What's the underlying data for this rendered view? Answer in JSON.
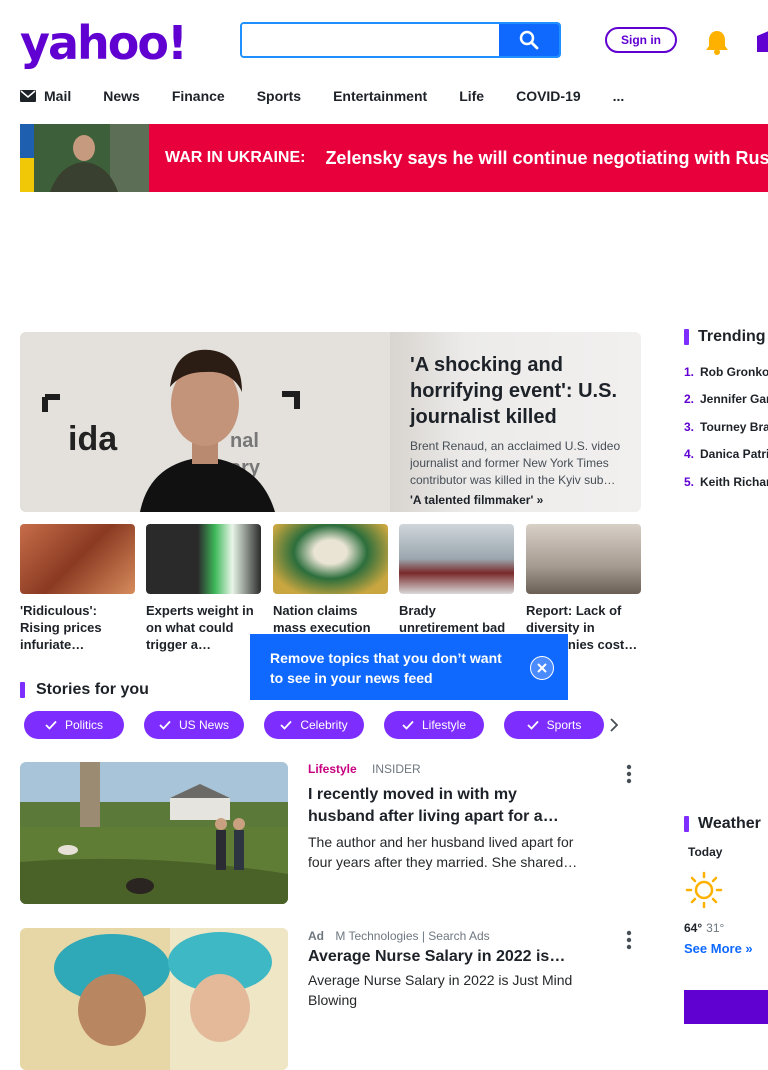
{
  "header": {
    "logo": "yahoo!",
    "search_placeholder": "",
    "sign_in": "Sign in"
  },
  "nav": {
    "items": [
      "Mail",
      "News",
      "Finance",
      "Sports",
      "Entertainment",
      "Life",
      "COVID-19",
      "..."
    ]
  },
  "banner": {
    "tag": "WAR IN UKRAINE:",
    "headline": "Zelensky says he will continue negotiating with Rus"
  },
  "hero": {
    "title": "'A shocking and horrifying event': U.S. journalist killed",
    "summary": "Brent Renaud, an acclaimed U.S. video journalist and former New York Times contributor was killed in the Kyiv sub…",
    "link": "'A talented filmmaker' »",
    "image_text": "ida"
  },
  "cards": [
    {
      "title": "'Ridiculous': Rising prices infuriate…"
    },
    {
      "title": "Experts weight in on what could trigger a…"
    },
    {
      "title": "Nation claims mass execution"
    },
    {
      "title": "Brady unretirement bad"
    },
    {
      "title": "Report: Lack of diversity in companies cost…"
    }
  ],
  "tooltip": {
    "text": "Remove topics that you don’t want to see in your news feed"
  },
  "stories_for_you": {
    "heading": "Stories for you",
    "topics": [
      "Politics",
      "US News",
      "Celebrity",
      "Lifestyle",
      "Sports"
    ]
  },
  "stories": [
    {
      "category": "Lifestyle",
      "source": "INSIDER",
      "title": "I recently moved in with my husband after living apart for a…",
      "description": "The author and her husband lived apart for four years after they married. She shared…"
    },
    {
      "category": "Ad",
      "source": "M Technologies | Search Ads",
      "title": "Average Nurse Salary in 2022 is…",
      "description": "Average Nurse Salary in 2022 is Just Mind Blowing"
    }
  ],
  "trending": {
    "heading": "Trending",
    "items": [
      {
        "rank": "1.",
        "name": "Rob Gronko"
      },
      {
        "rank": "2.",
        "name": "Jennifer Gar"
      },
      {
        "rank": "3.",
        "name": "Tourney Bra"
      },
      {
        "rank": "4.",
        "name": "Danica Patri"
      },
      {
        "rank": "5.",
        "name": "Keith Richar"
      }
    ]
  },
  "weather": {
    "heading": "Weather",
    "day": "Today",
    "high": "64°",
    "low": "31°",
    "see_more": "See More »"
  },
  "colors": {
    "brand": "#6001d2",
    "accent_blue": "#0f69ff",
    "banner_red": "#e8003d",
    "pill_purple": "#7d2eff"
  }
}
